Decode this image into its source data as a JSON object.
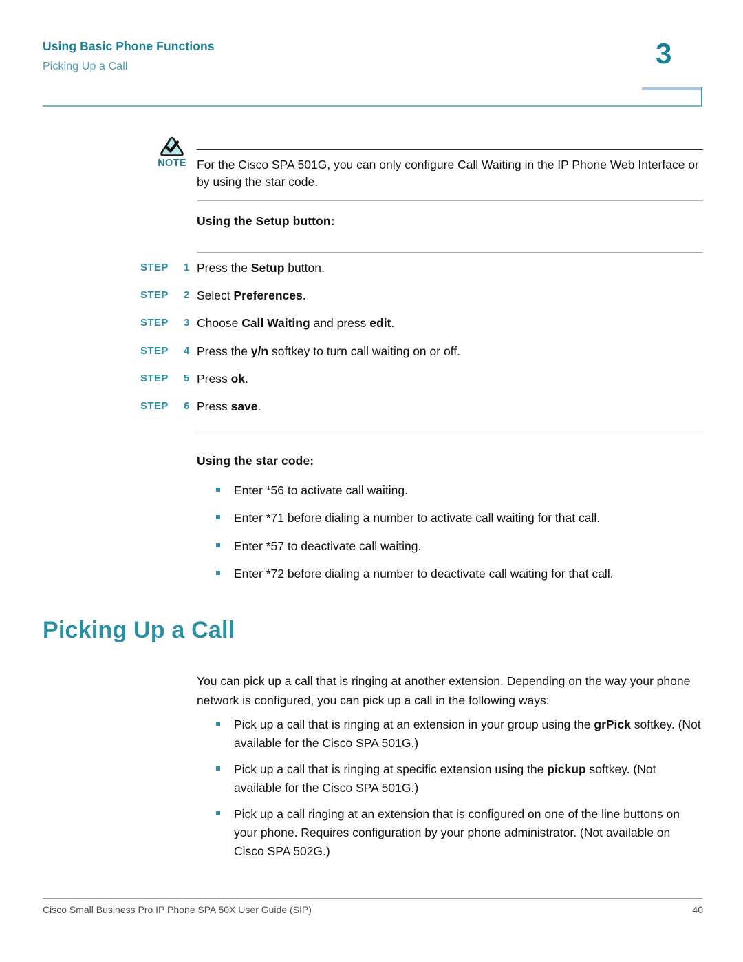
{
  "header": {
    "running_head": "Using Basic Phone Functions",
    "running_sub": "Picking Up a Call",
    "chapter_number": "3",
    "rule_color": "#6cbcc6",
    "accent_color": "#1b7f96"
  },
  "note": {
    "label": "NOTE",
    "icon": "note-triangle-check-icon",
    "text": "For the Cisco SPA 501G, you can only configure Call Waiting in the IP Phone Web Interface or by using the star code."
  },
  "setup_section": {
    "heading": "Using the Setup button:",
    "steps": [
      {
        "label": "STEP",
        "num": "1",
        "text_pre": "Press the ",
        "text_bold": "Setup",
        "text_post": " button."
      },
      {
        "label": "STEP",
        "num": "2",
        "text_pre": "Select ",
        "text_bold": "Preferences",
        "text_post": "."
      },
      {
        "label": "STEP",
        "num": "3",
        "text_pre": "Choose ",
        "text_bold": "Call Waiting",
        "text_post": " and press ",
        "text_bold2": "edit",
        "text_post2": "."
      },
      {
        "label": "STEP",
        "num": "4",
        "text_pre": "Press the ",
        "text_bold": "y/n",
        "text_post": " softkey to turn call waiting on or off."
      },
      {
        "label": "STEP",
        "num": "5",
        "text_pre": "Press ",
        "text_bold": "ok",
        "text_post": "."
      },
      {
        "label": "STEP",
        "num": "6",
        "text_pre": "Press ",
        "text_bold": "save",
        "text_post": "."
      }
    ]
  },
  "star_code_section": {
    "heading": "Using the star code:",
    "bullets": [
      "Enter *56 to activate call waiting.",
      "Enter *71 before dialing a number to activate call waiting for that call.",
      "Enter *57 to deactivate call waiting.",
      "Enter *72 before dialing a number to deactivate call waiting for that call."
    ]
  },
  "picking_up_section": {
    "heading": "Picking Up a Call",
    "paragraph": "You can pick up a call that is ringing at another extension. Depending on the way your phone network is configured, you can pick up a call in the following ways:",
    "bullets": [
      {
        "pre": "Pick up a call that is ringing at an extension in your group using the ",
        "bold": "grPick",
        "post": " softkey. (Not available for the Cisco SPA 501G.)"
      },
      {
        "pre": "Pick up a call that is ringing at specific extension using the ",
        "bold": "pickup",
        "post": " softkey. (Not available for the Cisco SPA 501G.)"
      },
      {
        "pre": "Pick up a call ringing at an extension that is configured on one of the line buttons on your phone. Requires configuration by your phone administrator. (Not available on Cisco SPA 502G.)",
        "bold": "",
        "post": ""
      }
    ]
  },
  "footer": {
    "left": "Cisco Small Business Pro IP Phone SPA 50X User Guide (SIP)",
    "page_number": "40"
  },
  "colors": {
    "teal": "#2a8fa3",
    "teal_dark": "#1b7f96",
    "teal_light": "#4a9fb5",
    "rule_teal": "#6cbcc6",
    "note_icon_fill": "#b9e4ea",
    "bar_blue": "#a8c4de"
  }
}
